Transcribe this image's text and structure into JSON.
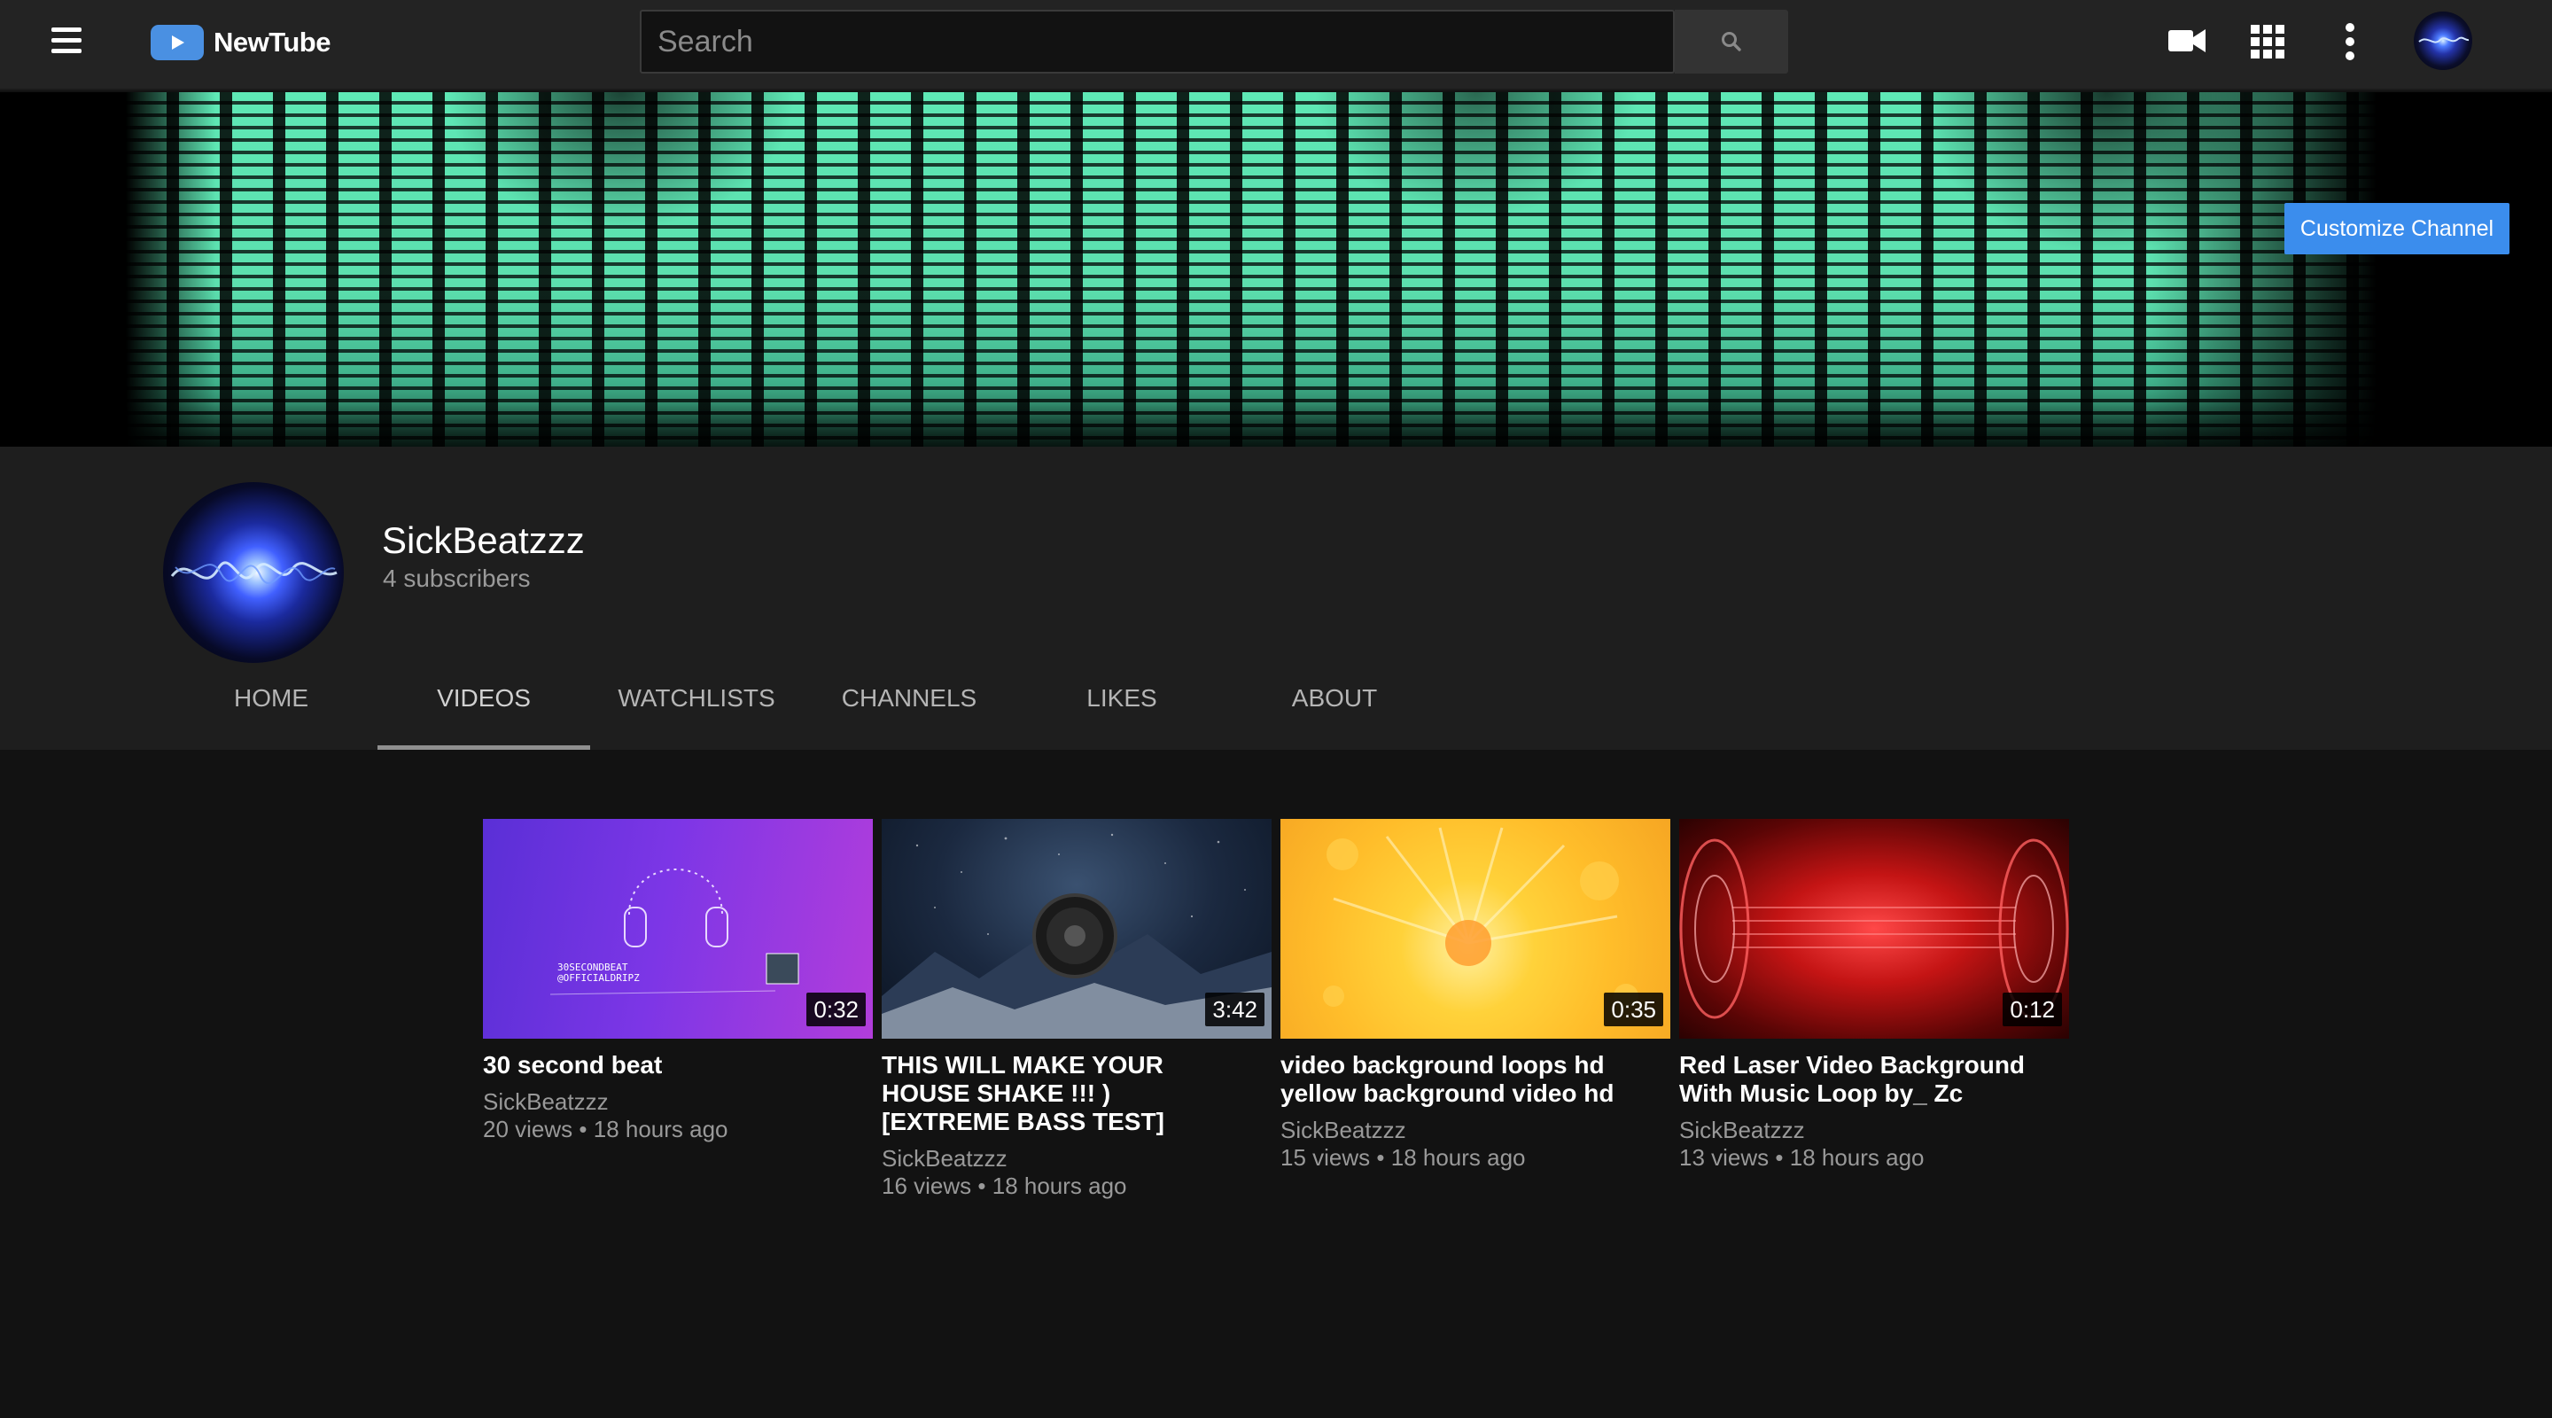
{
  "app": {
    "name": "NewTube",
    "search_placeholder": "Search"
  },
  "header_icons": [
    "menu-icon",
    "logo-play-icon",
    "search-icon",
    "video-camera-icon",
    "apps-grid-icon",
    "more-vertical-icon"
  ],
  "banner": {
    "customize_label": "Customize Channel"
  },
  "channel": {
    "name": "SickBeatzzz",
    "subscribers": "4 subscribers"
  },
  "tabs": [
    {
      "label": "HOME",
      "active": false
    },
    {
      "label": "VIDEOS",
      "active": true
    },
    {
      "label": "WATCHLISTS",
      "active": false
    },
    {
      "label": "CHANNELS",
      "active": false
    },
    {
      "label": "LIKES",
      "active": false
    },
    {
      "label": "ABOUT",
      "active": false
    }
  ],
  "videos": [
    {
      "title_lines": [
        "30 second beat"
      ],
      "channel": "SickBeatzzz",
      "views": "20 views",
      "age": "18 hours ago",
      "duration": "0:32",
      "thumb_text_1": "30SECONDBEAT",
      "thumb_text_2": "@OFFICIALDRIPZ"
    },
    {
      "title_lines": [
        "THIS WILL MAKE YOUR",
        "HOUSE SHAKE !!! )",
        "[EXTREME BASS TEST]"
      ],
      "channel": "SickBeatzzz",
      "views": "16 views",
      "age": "18 hours ago",
      "duration": "3:42"
    },
    {
      "title_lines": [
        "video background loops hd",
        "yellow background video hd"
      ],
      "channel": "SickBeatzzz",
      "views": "15 views",
      "age": "18 hours ago",
      "duration": "0:35"
    },
    {
      "title_lines": [
        "Red Laser Video Background",
        "With Music Loop by_ Zc"
      ],
      "channel": "SickBeatzzz",
      "views": "13 views",
      "age": "18 hours ago",
      "duration": "0:12"
    }
  ],
  "meta_separator": "•",
  "colors": {
    "topbar": "#232323",
    "page_bg": "#121212",
    "channel_header_bg": "#1e1e1e",
    "accent_blue": "#3b8ded",
    "logo_blue": "#4a90e2",
    "banner_green": "#5ee8b5"
  }
}
